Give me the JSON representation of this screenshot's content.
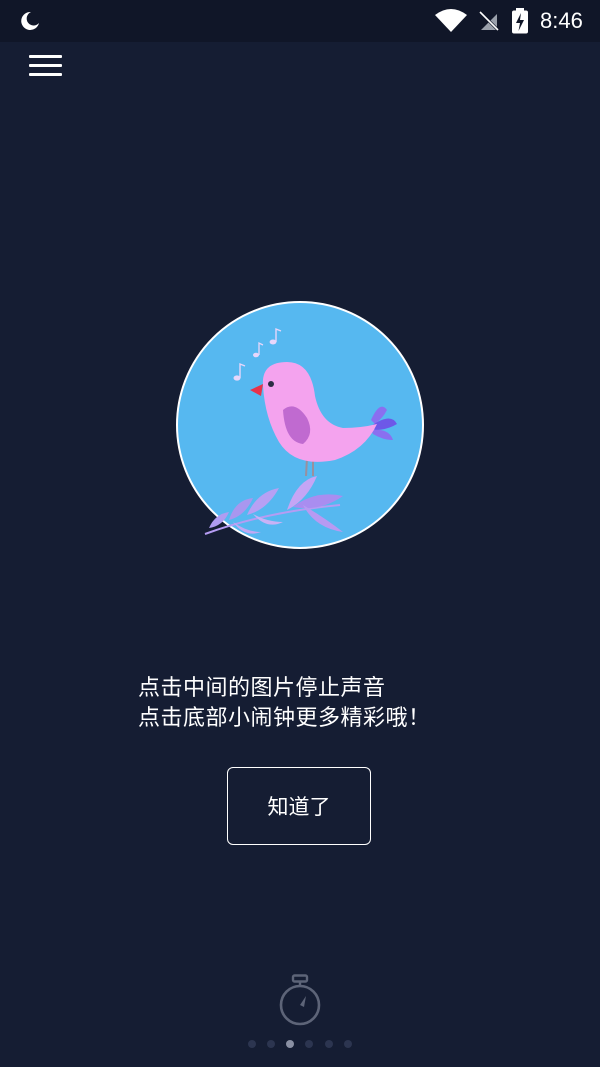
{
  "status_bar": {
    "time": "8:46",
    "icons": [
      "moon-icon",
      "wifi-icon",
      "no-signal-icon",
      "battery-charging-icon"
    ]
  },
  "toolbar": {
    "menu_icon": "hamburger-menu-icon"
  },
  "center_image": {
    "icon": "singing-bird-image",
    "disc_color": "#56b8f0"
  },
  "hint": {
    "line1": "点击中间的图片停止声音",
    "line2": "点击底部小闹钟更多精彩哦！"
  },
  "ok_button": {
    "label": "知道了"
  },
  "bottom": {
    "timer_icon": "stopwatch-icon",
    "page_count": 6,
    "active_page": 3
  },
  "colors": {
    "background": "#151d33",
    "status_bar": "#101628",
    "bird_disc": "#56b8f0",
    "bird": "#f4a3ee"
  }
}
